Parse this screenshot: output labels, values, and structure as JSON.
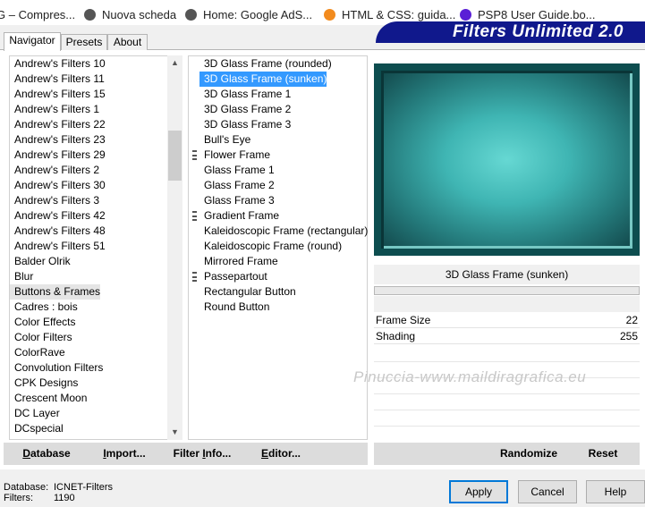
{
  "bookmarks": [
    {
      "label": "G – Compres...",
      "icon": "page-icon"
    },
    {
      "label": "Nuova scheda",
      "icon": "globe-icon"
    },
    {
      "label": "Home: Google AdS...",
      "icon": "globe-icon"
    },
    {
      "label": "HTML & CSS: guida...",
      "icon": "html-icon"
    },
    {
      "label": "PSP8 User Guide.bo...",
      "icon": "purple-dot-icon"
    }
  ],
  "banner": {
    "title": "Filters Unlimited 2.0"
  },
  "tabs": [
    "Navigator",
    "Presets",
    "About"
  ],
  "categories": [
    "Andrew's Filters 10",
    "Andrew's Filters 11",
    "Andrew's Filters 15",
    "Andrew's Filters 1",
    "Andrew's Filters 22",
    "Andrew's Filters 23",
    "Andrew's Filters 29",
    "Andrew's Filters 2",
    "Andrew's Filters 30",
    "Andrew's Filters 3",
    "Andrew's Filters 42",
    "Andrew's Filters 48",
    "Andrew's Filters 51",
    "Balder Olrik",
    "Blur",
    "Buttons & Frames",
    "Cadres : bois",
    "Color Effects",
    "Color Filters",
    "ColorRave",
    "Convolution Filters",
    "CPK Designs",
    "Crescent Moon",
    "DC Layer",
    "DCspecial"
  ],
  "selected_category": "Buttons & Frames",
  "filters": [
    {
      "label": "3D Glass Frame (rounded)",
      "group": false
    },
    {
      "label": "3D Glass Frame (sunken)",
      "group": false
    },
    {
      "label": "3D Glass Frame 1",
      "group": false
    },
    {
      "label": "3D Glass Frame 2",
      "group": false
    },
    {
      "label": "3D Glass Frame 3",
      "group": false
    },
    {
      "label": "Bull's Eye",
      "group": false
    },
    {
      "label": "Flower Frame",
      "group": true
    },
    {
      "label": "Glass Frame 1",
      "group": false
    },
    {
      "label": "Glass Frame 2",
      "group": false
    },
    {
      "label": "Glass Frame 3",
      "group": false
    },
    {
      "label": "Gradient Frame",
      "group": true
    },
    {
      "label": "Kaleidoscopic Frame (rectangular)",
      "group": false
    },
    {
      "label": "Kaleidoscopic Frame (round)",
      "group": false
    },
    {
      "label": "Mirrored Frame",
      "group": false
    },
    {
      "label": "Passepartout",
      "group": true
    },
    {
      "label": "Rectangular Button",
      "group": false
    },
    {
      "label": "Round Button",
      "group": false
    }
  ],
  "selected_filter": "3D Glass Frame (sunken)",
  "preview": {
    "filter_name": "3D Glass Frame (sunken)"
  },
  "params": [
    {
      "name": "Frame Size",
      "value": "22"
    },
    {
      "name": "Shading",
      "value": "255"
    }
  ],
  "watermark": "Pinuccia-www.maildiragrafica.eu",
  "left_buttons": [
    {
      "ul": "D",
      "rest": "atabase"
    },
    {
      "ul": "I",
      "rest": "mport..."
    },
    {
      "ul": "",
      "rest": "Filter Info...",
      "pre": "Filter ",
      "ul2": "I",
      "post": "nfo..."
    },
    {
      "ul": "E",
      "rest": "ditor..."
    }
  ],
  "right_buttons": [
    "Randomize",
    "Reset"
  ],
  "status": {
    "database_label": "Database:",
    "database_value": "ICNET-Filters",
    "filters_label": "Filters:",
    "filters_value": "1190"
  },
  "dialog_buttons": [
    "Apply",
    "Cancel",
    "Help"
  ],
  "colors": {
    "banner": "#10188c",
    "selection": "#3399ff",
    "preview": "#3fb5b3"
  }
}
